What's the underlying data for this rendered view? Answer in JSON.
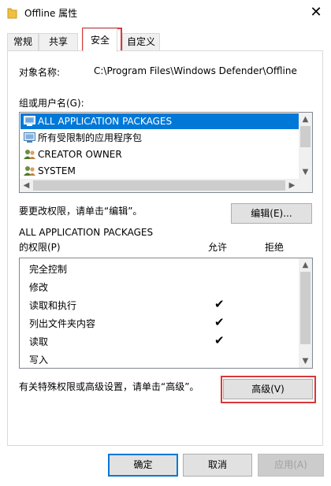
{
  "window": {
    "title": "Offline 属性",
    "close_symbol": "✕"
  },
  "tabs": [
    {
      "label": "常规"
    },
    {
      "label": "共享"
    },
    {
      "label": "安全"
    },
    {
      "label": "自定义"
    }
  ],
  "security": {
    "object_name_label": "对象名称:",
    "object_name_value": "C:\\Program Files\\Windows Defender\\Offline",
    "groups_label": "组或用户名(G):",
    "groups": [
      {
        "name": "ALL APPLICATION PACKAGES",
        "icon": "package-group-icon",
        "selected": true
      },
      {
        "name": "所有受限制的应用程序包",
        "icon": "package-group-icon",
        "selected": false
      },
      {
        "name": "CREATOR OWNER",
        "icon": "users-icon",
        "selected": false
      },
      {
        "name": "SYSTEM",
        "icon": "users-icon",
        "selected": false
      }
    ],
    "change_hint": "要更改权限，请单击“编辑”。",
    "edit_button": "编辑(E)...",
    "perm_for_line1": "ALL APPLICATION PACKAGES",
    "perm_for_line2": "的权限(P)",
    "allow_header": "允许",
    "deny_header": "拒绝",
    "permissions": [
      {
        "name": "完全控制",
        "allow": false,
        "deny": false
      },
      {
        "name": "修改",
        "allow": false,
        "deny": false
      },
      {
        "name": "读取和执行",
        "allow": true,
        "deny": false
      },
      {
        "name": "列出文件夹内容",
        "allow": true,
        "deny": false
      },
      {
        "name": "读取",
        "allow": true,
        "deny": false
      },
      {
        "name": "写入",
        "allow": false,
        "deny": false
      }
    ],
    "check_symbol": "✔",
    "advanced_hint": "有关特殊权限或高级设置，请单击“高级”。",
    "advanced_button": "高级(V)"
  },
  "buttons": {
    "ok": "确定",
    "cancel": "取消",
    "apply": "应用(A)"
  },
  "colors": {
    "selection": "#0078d7",
    "highlight_box": "#d9373a"
  }
}
